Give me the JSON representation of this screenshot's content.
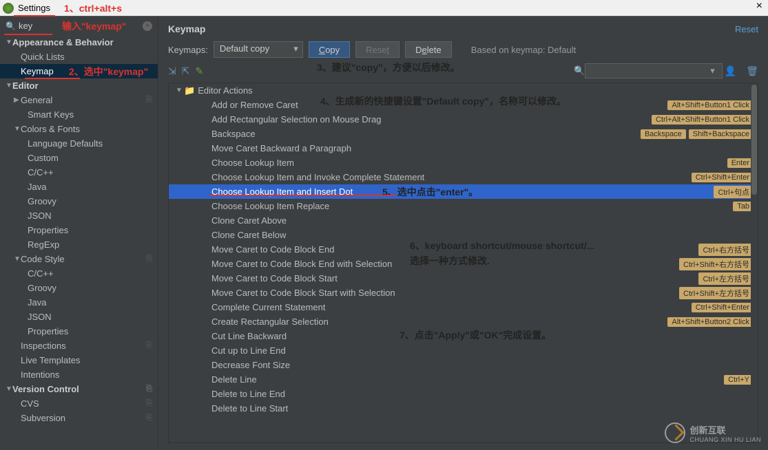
{
  "title": "Settings",
  "annotations": {
    "n1": "1、ctrl+alt+s",
    "n2": "输入\"keymap\"",
    "n3": "2、选中\"keymap\"",
    "n4": "3、建议\"copy\"，方便以后修改。",
    "n5": "4、生成新的快捷键设置\"Default copy\"，名称可以修改。",
    "n6": "5、选中点击\"enter\"。",
    "n7a": "6、keyboard shortcut/mouse shortcut/...",
    "n7b": "选择一种方式修改.",
    "n8": "7、点击\"Apply\"或\"OK\"完成设置。"
  },
  "search": {
    "value": "key"
  },
  "sidebar": [
    {
      "label": "Appearance & Behavior",
      "level": 0,
      "arrow": "▼",
      "header": true
    },
    {
      "label": "Quick Lists",
      "level": 1
    },
    {
      "label": "Keymap",
      "level": 1,
      "selected": true,
      "note": "n3"
    },
    {
      "label": "Editor",
      "level": 0,
      "arrow": "▼",
      "header": true
    },
    {
      "label": "General",
      "level": 1,
      "arrow": "▶",
      "cfg": true
    },
    {
      "label": "Smart Keys",
      "level": 2
    },
    {
      "label": "Colors & Fonts",
      "level": 1,
      "arrow": "▼"
    },
    {
      "label": "Language Defaults",
      "level": 2
    },
    {
      "label": "Custom",
      "level": 2
    },
    {
      "label": "C/C++",
      "level": 2
    },
    {
      "label": "Java",
      "level": 2
    },
    {
      "label": "Groovy",
      "level": 2
    },
    {
      "label": "JSON",
      "level": 2
    },
    {
      "label": "Properties",
      "level": 2
    },
    {
      "label": "RegExp",
      "level": 2
    },
    {
      "label": "Code Style",
      "level": 1,
      "arrow": "▼",
      "cfg": true
    },
    {
      "label": "C/C++",
      "level": 2
    },
    {
      "label": "Groovy",
      "level": 2
    },
    {
      "label": "Java",
      "level": 2
    },
    {
      "label": "JSON",
      "level": 2
    },
    {
      "label": "Properties",
      "level": 2
    },
    {
      "label": "Inspections",
      "level": 1,
      "cfg": true
    },
    {
      "label": "Live Templates",
      "level": 1
    },
    {
      "label": "Intentions",
      "level": 1
    },
    {
      "label": "Version Control",
      "level": 0,
      "arrow": "▼",
      "header": true,
      "cfg": true
    },
    {
      "label": "CVS",
      "level": 1,
      "cfg": true
    },
    {
      "label": "Subversion",
      "level": 1,
      "cfg": true
    }
  ],
  "main": {
    "title": "Keymap",
    "reset": "Reset",
    "keymaps_label": "Keymaps:",
    "keymap_selected": "Default copy",
    "btn_copy": "Copy",
    "btn_reset": "Reset",
    "btn_delete": "Delete",
    "based_on": "Based on keymap: Default",
    "group": "Editor Actions",
    "actions": [
      {
        "label": "Add or Remove Caret",
        "sc": [
          "Alt+Shift+Button1 Click"
        ]
      },
      {
        "label": "Add Rectangular Selection on Mouse Drag",
        "sc": [
          "Ctrl+Alt+Shift+Button1 Click"
        ]
      },
      {
        "label": "Backspace",
        "sc": [
          "Backspace",
          "Shift+Backspace"
        ]
      },
      {
        "label": "Move Caret Backward a Paragraph"
      },
      {
        "label": "Choose Lookup Item",
        "sc": [
          "Enter"
        ]
      },
      {
        "label": "Choose Lookup Item and Invoke Complete Statement",
        "sc": [
          "Ctrl+Shift+Enter"
        ]
      },
      {
        "label": "Choose Lookup Item and Insert Dot",
        "sc": [
          "Ctrl+句点"
        ],
        "selected": true
      },
      {
        "label": "Choose Lookup Item Replace",
        "sc": [
          "Tab"
        ]
      },
      {
        "label": "Clone Caret Above"
      },
      {
        "label": "Clone Caret Below"
      },
      {
        "label": "Move Caret to Code Block End",
        "sc": [
          "Ctrl+右方括号"
        ]
      },
      {
        "label": "Move Caret to Code Block End with Selection",
        "sc": [
          "Ctrl+Shift+右方括号"
        ]
      },
      {
        "label": "Move Caret to Code Block Start",
        "sc": [
          "Ctrl+左方括号"
        ]
      },
      {
        "label": "Move Caret to Code Block Start with Selection",
        "sc": [
          "Ctrl+Shift+左方括号"
        ]
      },
      {
        "label": "Complete Current Statement",
        "sc": [
          "Ctrl+Shift+Enter"
        ]
      },
      {
        "label": "Create Rectangular Selection",
        "sc": [
          "Alt+Shift+Button2 Click"
        ]
      },
      {
        "label": "Cut Line Backward"
      },
      {
        "label": "Cut up to Line End"
      },
      {
        "label": "Decrease Font Size"
      },
      {
        "label": "Delete Line",
        "sc": [
          "Ctrl+Y"
        ]
      },
      {
        "label": "Delete to Line End"
      },
      {
        "label": "Delete to Line Start"
      }
    ]
  },
  "watermark": "创新互联"
}
